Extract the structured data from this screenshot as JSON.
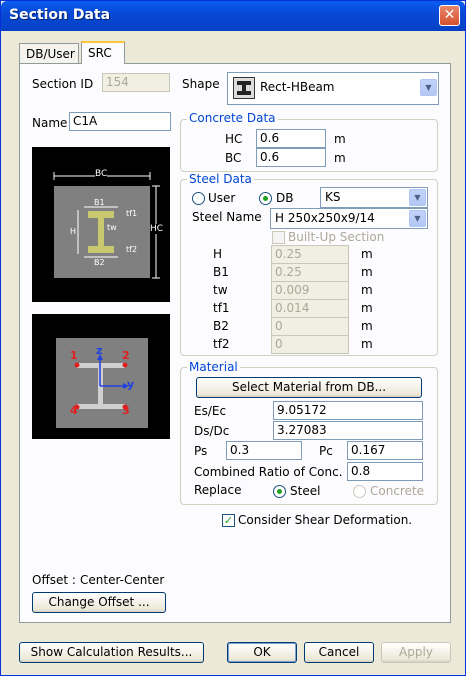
{
  "window": {
    "title": "Section Data",
    "close_glyph": "✕"
  },
  "tabs": [
    {
      "label": "DB/User"
    },
    {
      "label": "SRC"
    }
  ],
  "section": {
    "id_label": "Section ID",
    "id_value": "154",
    "name_label": "Name",
    "name_value": "C1A"
  },
  "shape": {
    "label": "Shape",
    "value": "Rect-HBeam",
    "icon": "h-beam-icon"
  },
  "concrete": {
    "title": "Concrete Data",
    "hc_label": "HC",
    "hc_value": "0.6",
    "bc_label": "BC",
    "bc_value": "0.6",
    "unit": "m"
  },
  "steel": {
    "title": "Steel Data",
    "user_label": "User",
    "db_label": "DB",
    "db_value": "KS",
    "name_label": "Steel Name",
    "name_value": "H 250x250x9/14",
    "builtup_label": "Built-Up Section",
    "unit": "m",
    "dims": [
      {
        "label": "H",
        "value": "0.25"
      },
      {
        "label": "B1",
        "value": "0.25"
      },
      {
        "label": "tw",
        "value": "0.009"
      },
      {
        "label": "tf1",
        "value": "0.014"
      },
      {
        "label": "B2",
        "value": "0"
      },
      {
        "label": "tf2",
        "value": "0"
      }
    ]
  },
  "material": {
    "title": "Material",
    "select_button": "Select Material from DB...",
    "es_label": "Es/Ec",
    "es_value": "9.05172",
    "ds_label": "Ds/Dc",
    "ds_value": "3.27083",
    "ps_label": "Ps",
    "ps_value": "0.3",
    "pc_label": "Pc",
    "pc_value": "0.167",
    "ratio_label": "Combined Ratio of Conc.",
    "ratio_value": "0.8",
    "replace_label": "Replace",
    "steel_label": "Steel",
    "concrete_label": "Concrete"
  },
  "shear": {
    "label": "Consider Shear Deformation."
  },
  "offset": {
    "label": "Offset :",
    "value": "Center-Center",
    "button": "Change Offset ..."
  },
  "diagram1": {
    "bc": "BC",
    "hc": "HC",
    "b1": "B1",
    "b2": "B2",
    "h": "H",
    "tw": "tw",
    "tf1": "tf1",
    "tf2": "tf2"
  },
  "diagram2": {
    "p1": "1",
    "p2": "2",
    "p3": "3",
    "p4": "4",
    "z": "z",
    "y": "y"
  },
  "footer": {
    "calc_button": "Show Calculation Results...",
    "ok": "OK",
    "cancel": "Cancel",
    "apply": "Apply"
  },
  "colors": {
    "accent": "#0046d5",
    "title_bar": "#0a5df0",
    "beam_fill": "#c8c86e",
    "point_red": "#e02020",
    "axis_blue": "#2040e0"
  }
}
